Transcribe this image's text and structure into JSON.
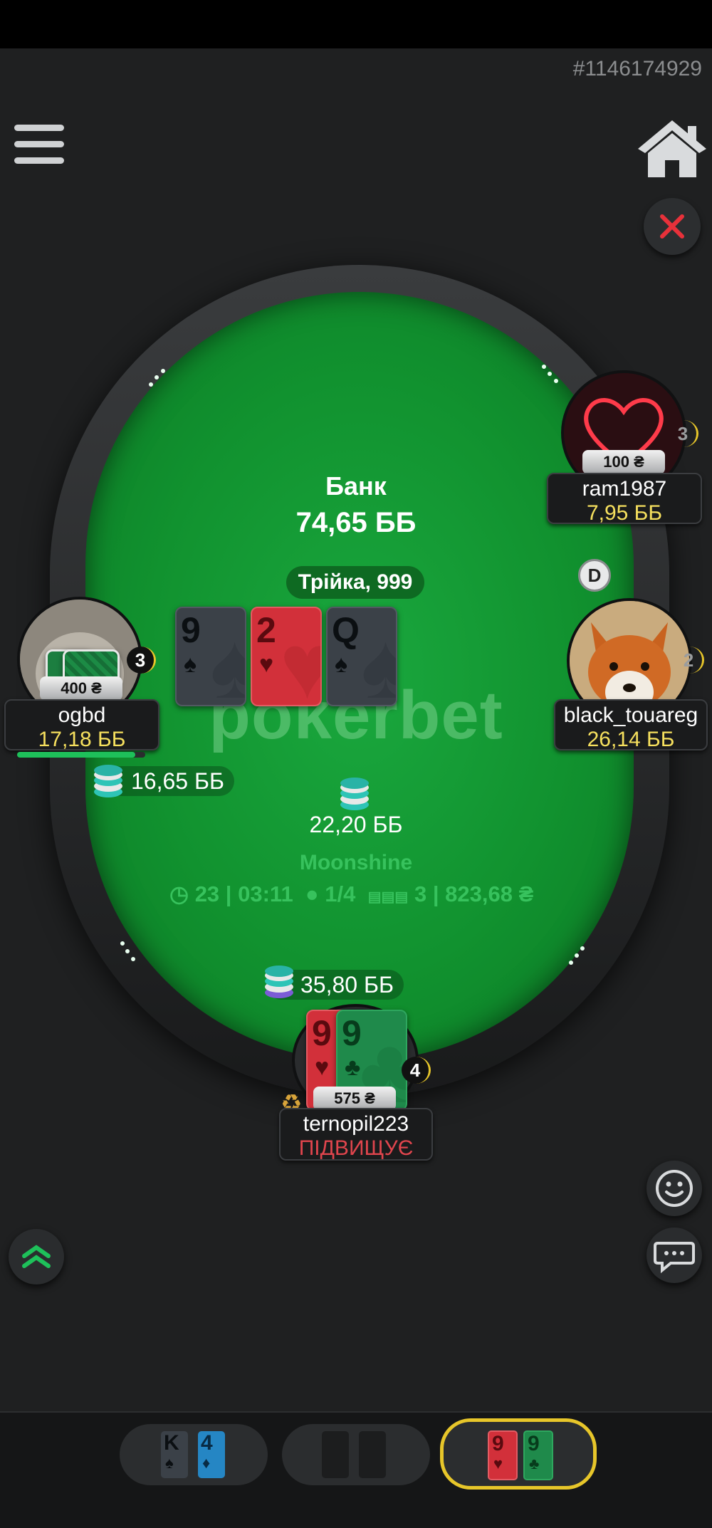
{
  "hand_id": "#1146174929",
  "pot": {
    "label": "Банк",
    "value": "74,65 ББ"
  },
  "hand_strength": "Трійка, 999",
  "watermark": "pokerbet",
  "board": [
    {
      "rank": "9",
      "suit": "♠",
      "color": "gray"
    },
    {
      "rank": "2",
      "suit": "♥",
      "color": "red"
    },
    {
      "rank": "Q",
      "suit": "♠",
      "color": "gray"
    }
  ],
  "players": {
    "ram1987": {
      "name": "ram1987",
      "stack": "7,95 ББ",
      "buyin": "100 ₴",
      "count": "3"
    },
    "black_touareg": {
      "name": "black_touareg",
      "stack": "26,14 ББ",
      "count": "2"
    },
    "ogbd": {
      "name": "ogbd",
      "stack": "17,18 ББ",
      "buyin": "400 ₴",
      "count": "3",
      "bet": "16,65 ББ"
    },
    "hero": {
      "name": "ternopil223",
      "action": "ПІДВИЩУЄ",
      "buyin": "575 ₴",
      "count": "4",
      "bet": "35,80 ББ",
      "cards": [
        {
          "rank": "9",
          "suit": "♥"
        },
        {
          "rank": "9",
          "suit": "♣"
        }
      ]
    }
  },
  "center_bet": "22,20 ББ",
  "table": {
    "name": "Moonshine",
    "hands": "23",
    "time": "03:11",
    "players": "1/4",
    "place": "3",
    "prize": "823,68 ₴"
  },
  "dealer_label": "D",
  "tabs": [
    {
      "cards": [
        {
          "rank": "K",
          "suit": "♠"
        },
        {
          "rank": "4",
          "suit": "♦"
        }
      ]
    },
    {
      "cards": []
    },
    {
      "cards": [
        {
          "rank": "9",
          "suit": "♥"
        },
        {
          "rank": "9",
          "suit": "♣"
        }
      ],
      "active": true
    }
  ],
  "colors": {
    "accent": "#e7c62a",
    "felt": "#11922f",
    "stack_text": "#f6e05e",
    "action_text": "#e0454d"
  }
}
